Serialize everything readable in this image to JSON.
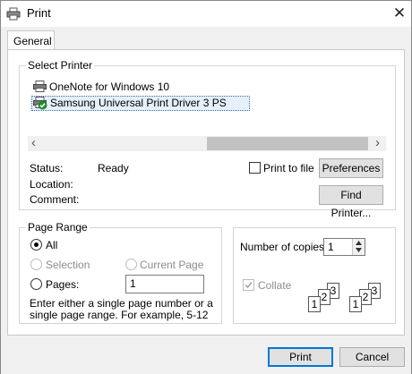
{
  "window": {
    "title": "Print",
    "close_glyph": "✕"
  },
  "tabs": [
    {
      "label": "General"
    }
  ],
  "select_printer": {
    "group_label": "Select Printer",
    "printers": [
      {
        "name": "OneNote for Windows 10",
        "selected": false
      },
      {
        "name": "Samsung Universal Print Driver 3 PS",
        "selected": true
      }
    ],
    "scroll_left": "‹",
    "scroll_right": "›",
    "status_label": "Status:",
    "status_value": "Ready",
    "location_label": "Location:",
    "location_value": "",
    "comment_label": "Comment:",
    "comment_value": "",
    "print_to_file_label": "Print to file",
    "print_to_file_checked": false,
    "preferences_button": "Preferences",
    "find_printer_button": "Find Printer..."
  },
  "page_range": {
    "group_label": "Page Range",
    "all_label": "All",
    "selection_label": "Selection",
    "current_page_label": "Current Page",
    "pages_label": "Pages:",
    "pages_value": "1",
    "hint": "Enter either a single page number or a single page range.  For example, 5-12",
    "selected": "all"
  },
  "copies": {
    "number_label": "Number of copies:",
    "number_value": "1",
    "collate_label": "Collate",
    "collate_checked": true,
    "collate_pages": [
      "1",
      "2",
      "3"
    ]
  },
  "footer": {
    "print_button": "Print",
    "cancel_button": "Cancel"
  }
}
